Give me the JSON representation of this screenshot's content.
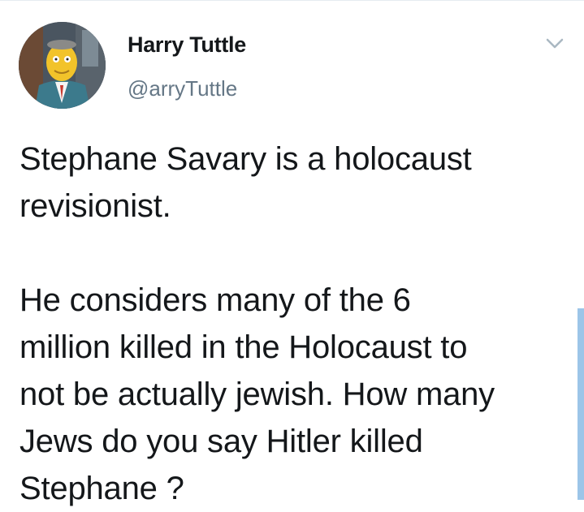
{
  "tweet": {
    "display_name": "Harry Tuttle",
    "handle": "@arryTuttle",
    "avatar_icon": "profile-avatar",
    "menu_icon": "chevron-down-icon",
    "text_paragraph_1_line_1": "Stephane Savary is a holocaust",
    "text_paragraph_1_line_2": "revisionist.",
    "text_paragraph_2_line_1": "He considers many of the 6",
    "text_paragraph_2_line_2": "million killed in the Holocaust to",
    "text_paragraph_2_line_3": "not be actually jewish. How many",
    "text_paragraph_2_line_4": "Jews do you say Hitler killed",
    "text_paragraph_2_line_5": "Stephane ?"
  },
  "colors": {
    "text": "#14171a",
    "secondary_text": "#657786",
    "chevron": "#aab8c2",
    "accent_scroll": "#9cc5e8"
  }
}
